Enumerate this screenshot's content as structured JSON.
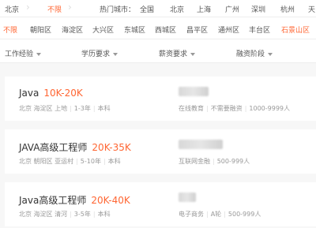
{
  "city_bar": {
    "current_city": "北京",
    "unlimited": "不限",
    "hot_label": "热门城市：",
    "cities": [
      "全国",
      "北京",
      "上海",
      "广州",
      "深圳",
      "杭州",
      "天"
    ]
  },
  "districts": [
    "不限",
    "朝阳区",
    "海淀区",
    "大兴区",
    "东城区",
    "西城区",
    "昌平区",
    "通州区",
    "丰台区",
    "石景山区"
  ],
  "filters": [
    "工作经验",
    "学历要求",
    "薪资要求",
    "融资阶段"
  ],
  "jobs": [
    {
      "title": "Java",
      "salary": "10K-20K",
      "location": "北京 海淀区 上地",
      "experience": "1-3年",
      "education": "本科",
      "industry": "在线教育",
      "funding": "不需要融资",
      "size": "1000-9999人"
    },
    {
      "title": "JAVA高级工程师",
      "salary": "20K-35K",
      "location": "北京 朝阳区 亚运村",
      "experience": "5-10年",
      "education": "本科",
      "industry": "互联网金融",
      "funding": "",
      "size": "500-999人"
    },
    {
      "title": "Java高级工程师",
      "salary": "20K-40K",
      "location": "北京 海淀区 清河",
      "experience": "3-5年",
      "education": "本科",
      "industry": "电子商务",
      "funding": "A轮",
      "size": "500-999人"
    }
  ]
}
